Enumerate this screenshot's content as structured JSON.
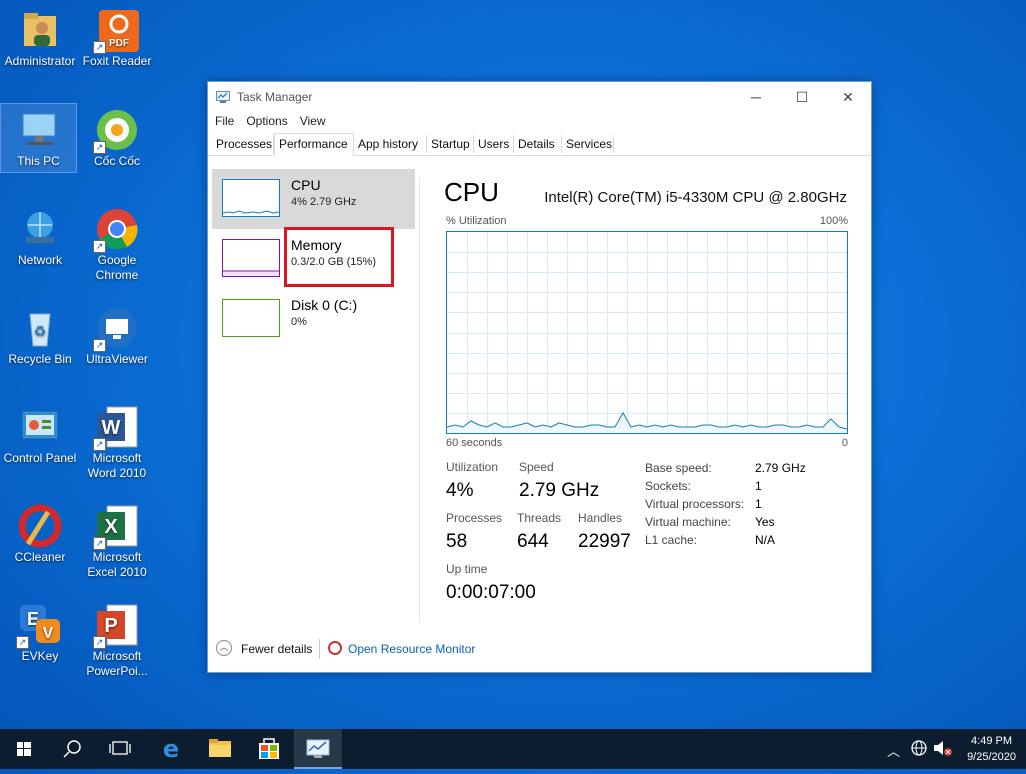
{
  "desktop": {
    "icons": [
      {
        "label": "Administrator"
      },
      {
        "label": "Foxit Reader"
      },
      {
        "label": "This PC"
      },
      {
        "label": "Cốc Cốc"
      },
      {
        "label": "Network"
      },
      {
        "label": "Google Chrome"
      },
      {
        "label": "Recycle Bin"
      },
      {
        "label": "UltraViewer"
      },
      {
        "label": "Control Panel"
      },
      {
        "label": "Microsoft Word 2010"
      },
      {
        "label": "CCleaner"
      },
      {
        "label": "Microsoft Excel 2010"
      },
      {
        "label": "EVKey"
      },
      {
        "label": "Microsoft PowerPoi..."
      }
    ]
  },
  "window": {
    "title": "Task Manager",
    "menu": [
      "File",
      "Options",
      "View"
    ],
    "tabs": [
      "Processes",
      "Performance",
      "App history",
      "Startup",
      "Users",
      "Details",
      "Services"
    ],
    "active_tab": "Performance"
  },
  "resources": [
    {
      "name": "CPU",
      "value": "4%  2.79 GHz",
      "color": "#117dbb"
    },
    {
      "name": "Memory",
      "value": "0.3/2.0 GB (15%)",
      "color": "#8b12ae"
    },
    {
      "name": "Disk 0 (C:)",
      "value": "0%",
      "color": "#4da60c"
    }
  ],
  "detail": {
    "title": "CPU",
    "model": "Intel(R) Core(TM) i5-4330M CPU @ 2.80GHz",
    "graph_label": "% Utilization",
    "graph_max": "100%",
    "graph_time": "60 seconds",
    "graph_min": "0",
    "utilization_history": [
      3,
      4,
      3,
      6,
      4,
      3,
      5,
      3,
      3,
      4,
      5,
      3,
      4,
      3,
      5,
      4,
      3,
      3,
      4,
      4,
      3,
      3,
      10,
      3,
      4,
      3,
      4,
      3,
      4,
      3,
      3,
      3,
      4,
      4,
      3,
      3,
      4,
      3,
      4,
      3,
      3,
      4,
      4,
      3,
      3,
      4,
      3,
      3,
      7,
      3,
      2
    ],
    "stats": {
      "utilization_label": "Utilization",
      "utilization": "4%",
      "speed_label": "Speed",
      "speed": "2.79 GHz",
      "processes_label": "Processes",
      "processes": "58",
      "threads_label": "Threads",
      "threads": "644",
      "handles_label": "Handles",
      "handles": "22997",
      "uptime_label": "Up time",
      "uptime": "0:00:07:00"
    },
    "specs": [
      {
        "k": "Base speed:",
        "v": "2.79 GHz"
      },
      {
        "k": "Sockets:",
        "v": "1"
      },
      {
        "k": "Virtual processors:",
        "v": "1"
      },
      {
        "k": "Virtual machine:",
        "v": "Yes"
      },
      {
        "k": "L1 cache:",
        "v": "N/A"
      }
    ]
  },
  "footer": {
    "fewer": "Fewer details",
    "resource_monitor": "Open Resource Monitor"
  },
  "taskbar": {
    "time": "4:49 PM",
    "date": "9/25/2020"
  }
}
